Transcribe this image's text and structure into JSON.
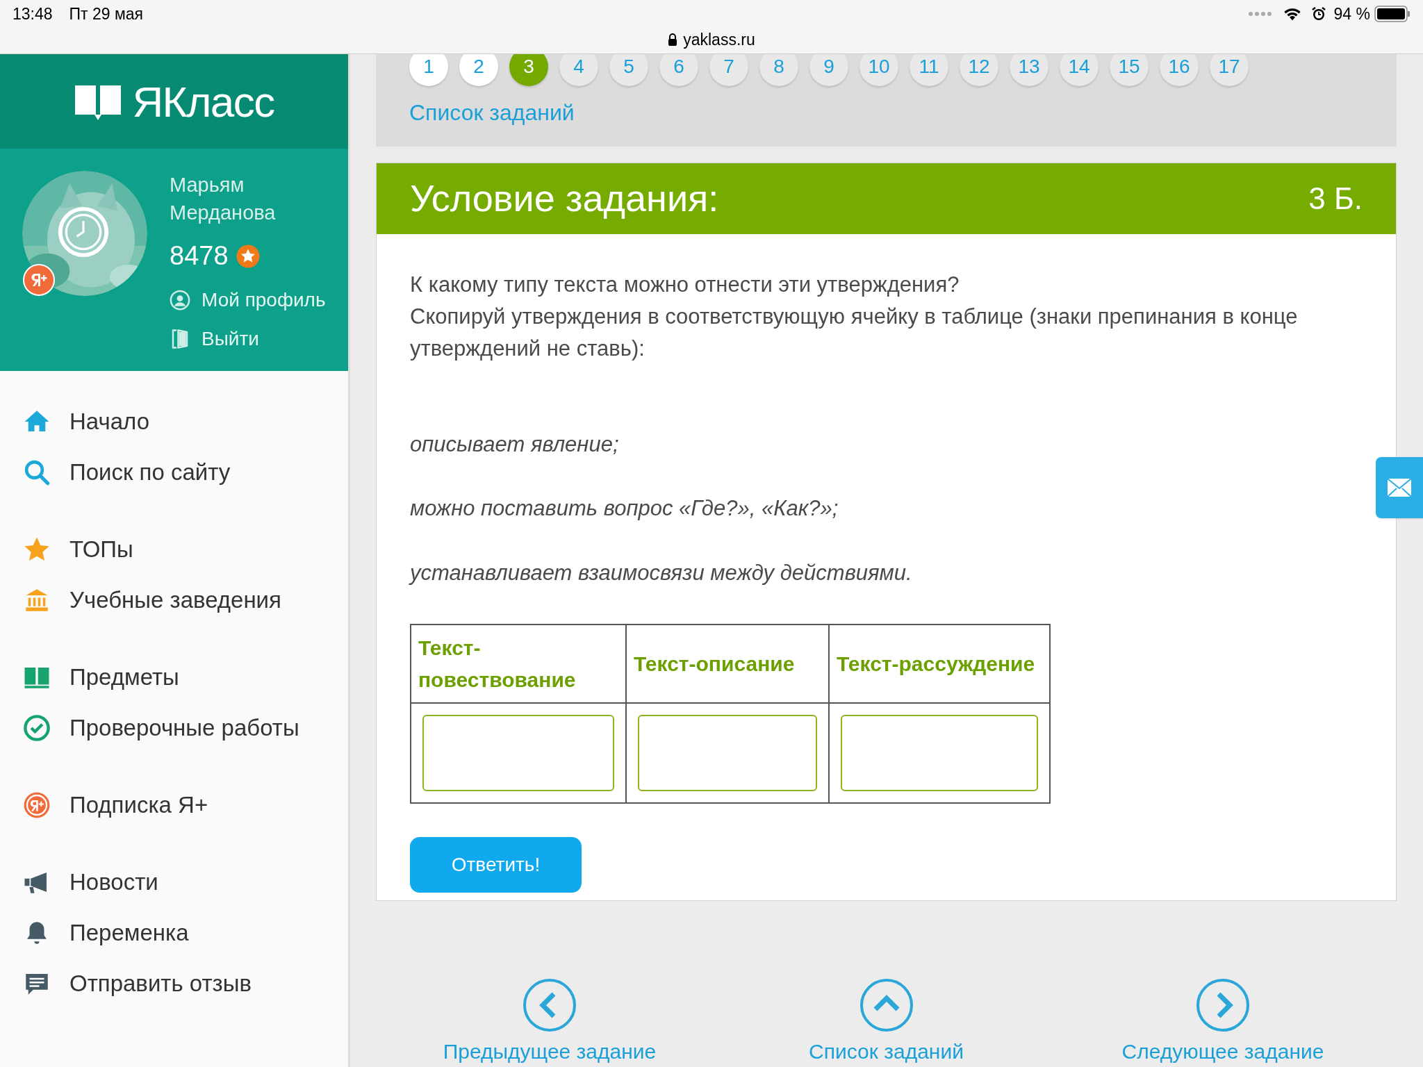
{
  "status_bar": {
    "time": "13:48",
    "date": "Пт 29 мая",
    "url": "yaklass.ru",
    "battery": "94 %"
  },
  "sidebar": {
    "logo": "ЯКласс",
    "user": {
      "name": "Марьям Мерданова",
      "points": "8478",
      "links": [
        "Мой профиль",
        "Выйти"
      ]
    },
    "nav_groups": [
      [
        "Начало",
        "Поиск по сайту"
      ],
      [
        "ТОПы",
        "Учебные заведения"
      ],
      [
        "Предметы",
        "Проверочные работы"
      ],
      [
        "Подписка Я+"
      ],
      [
        "Новости",
        "Переменка",
        "Отправить отзыв"
      ]
    ]
  },
  "pagination": {
    "pages": [
      {
        "label": "1",
        "selected": false
      },
      {
        "label": "2",
        "selected": false
      },
      {
        "label": "3",
        "selected": true
      },
      {
        "label": "4",
        "selected": false
      },
      {
        "label": "5",
        "selected": false
      },
      {
        "label": "6",
        "selected": false
      },
      {
        "label": "7",
        "selected": false
      },
      {
        "label": "8",
        "selected": false
      },
      {
        "label": "9",
        "selected": false
      },
      {
        "label": "10",
        "selected": false
      },
      {
        "label": "11",
        "selected": false
      },
      {
        "label": "12",
        "selected": false
      },
      {
        "label": "13",
        "selected": false
      },
      {
        "label": "14",
        "selected": false
      },
      {
        "label": "15",
        "selected": false
      },
      {
        "label": "16",
        "selected": false
      },
      {
        "label": "17",
        "selected": false
      }
    ],
    "task_list_link": "Список заданий"
  },
  "task": {
    "title": "Условие задания:",
    "points": "3 Б.",
    "question": [
      "К какому типу текста можно отнести эти утверждения?",
      "Скопируй утверждения в соответствующую ячейку в таблице (знаки препинания в конце утверждений не ставь):"
    ],
    "statements": [
      "описывает явление;",
      "можно поставить вопрос «Где?», «Как?»;",
      "устанавливает взаимосвязи между действиями."
    ],
    "table": {
      "columns": [
        "Текст-повествование",
        "Текст-описание",
        "Текст-рассуждение"
      ]
    },
    "submit": "Ответить!"
  },
  "bottom_nav": [
    "Предыдущее задание",
    "Список заданий",
    "Следующее задание"
  ]
}
